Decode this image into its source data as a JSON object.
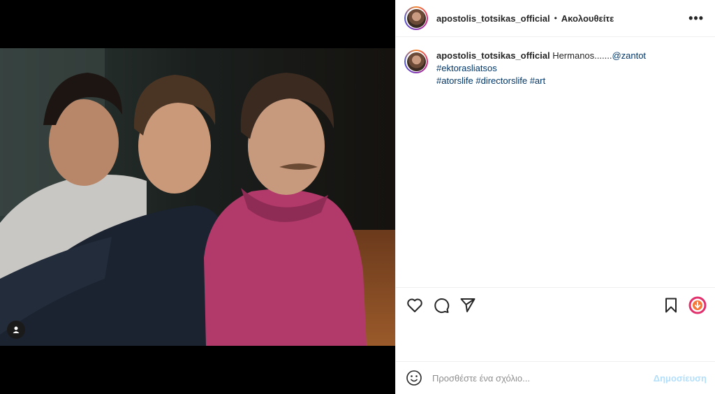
{
  "post": {
    "username": "apostolis_totsikas_official",
    "separator": "•",
    "follow_label": "Ακολουθείτε",
    "more_icon": "more-horizontal-icon",
    "caption_text": "Hermanos.......",
    "caption_mentions": [
      "@zantot",
      "#ektorasliatsos",
      "#atorslife",
      "#directorslife",
      "#art"
    ]
  },
  "actions": {
    "like_icon": "heart-icon",
    "comment_icon": "comment-icon",
    "share_icon": "share-icon",
    "save_icon": "bookmark-icon",
    "download_icon": "download-icon"
  },
  "comment": {
    "placeholder": "Προσθέστε ένα σχόλιο...",
    "post_label": "Δημοσίευση",
    "emoji_icon": "emoji-icon"
  },
  "colors": {
    "link": "#00376b",
    "post_disabled": "#b2dffc",
    "hoodie": "#b23a6a"
  }
}
